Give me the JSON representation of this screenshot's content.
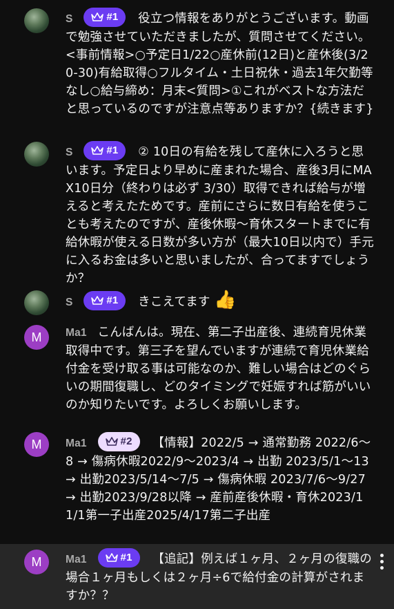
{
  "messages": [
    {
      "author": "S",
      "badge": "#1",
      "text": "役立つ情報をありがとうございます。動画で勉強させていただきましたが、質問させてください。<事前情報>○予定日1/22○産休前(12日)と産休後(3/20-30)有給取得○フルタイム・土日祝休・過去1年欠勤等なし○給与締め：月末<質問>①これがベストな方法だと思っているのですが注意点等ありますか？{続きます}"
    },
    {
      "author": "S",
      "badge": "#1",
      "text": "② 10日の有給を残して産休に入ろうと思います。予定日より早めに産まれた場合、産後3月にMAX10日分（終わりは必ず 3/30）取得できれば給与が増えると考えたためです。産前にさらに数日有給を使うことも考えたのですが、産後休暇〜育休スタートまでに有給休暇が使える日数が多い方が（最大10日以内で）手元に入るお金は多いと思いましたが、合ってますでしょうか？"
    },
    {
      "author": "S",
      "badge": "#1",
      "text": "きこえてます",
      "emoji": "👍"
    },
    {
      "author": "Ma1",
      "avatar_letter": "M",
      "text": "こんばんは。現在、第二子出産後、連続育児休業取得中です。第三子を望んでいますが連続で育児休業給付金を受け取る事は可能なのか、難しい場合はどのぐらいの期間復職し、どのタイミングで妊娠すれば筋がいいのか知りたいです。よろしくお願いします。"
    },
    {
      "author": "Ma1",
      "avatar_letter": "M",
      "badge": "#2",
      "text": "【情報】2022/5 → 通常勤務 2022/6〜8 → 傷病休暇2022/9〜2023/4 → 出勤 2023/5/1〜13 → 出勤2023/5/14〜7/5 → 傷病休暇 2023/7/6〜9/27 → 出勤2023/9/28以降 → 産前産後休暇・育休2023/11/1第一子出産2025/4/17第二子出産"
    },
    {
      "author": "Ma1",
      "avatar_letter": "M",
      "badge": "#1",
      "text": "【追記】例えば１ヶ月、２ヶ月の復職の場合１ヶ月もしくは２ヶ月÷6で給付金の計算がされますか？？"
    }
  ],
  "colors": {
    "background": "#0f0f0f",
    "highlight_row": "#272727",
    "badge_purple": "#6b3cf2",
    "badge_light": "#eddcff",
    "avatar_m": "#9c3ec4",
    "author": "#aaaaaa"
  }
}
